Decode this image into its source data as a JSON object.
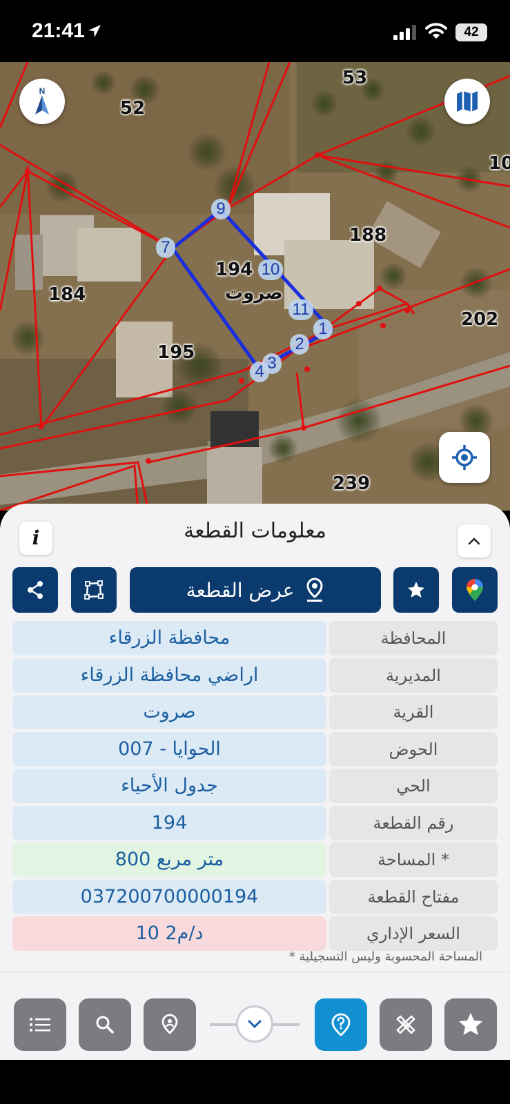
{
  "status_bar": {
    "time": "21:41",
    "battery": "42"
  },
  "map": {
    "parcels": [
      {
        "id": "p52",
        "label": "52"
      },
      {
        "id": "p53",
        "label": "53"
      },
      {
        "id": "p10x",
        "label": "10"
      },
      {
        "id": "p188",
        "label": "188"
      },
      {
        "id": "p184",
        "label": "184"
      },
      {
        "id": "p194",
        "label": "194"
      },
      {
        "id": "p195",
        "label": "195"
      },
      {
        "id": "p202",
        "label": "202"
      },
      {
        "id": "p239",
        "label": "239"
      }
    ],
    "village_label": "صروت",
    "vertices": [
      "9",
      "7",
      "10",
      "11",
      "1",
      "2",
      "3",
      "4"
    ],
    "north_label": "N"
  },
  "panel": {
    "title": "معلومات القطعة",
    "info_label": "i",
    "show_parcel_label": "عرض القطعة",
    "rows": [
      {
        "key": "المحافظة",
        "value": "محافظة الزرقاء"
      },
      {
        "key": "المديرية",
        "value": "اراضي محافظة الزرقاء"
      },
      {
        "key": "القرية",
        "value": "صروت"
      },
      {
        "key": "الحوض",
        "value": "الحوايا - 007"
      },
      {
        "key": "الحي",
        "value": "جدول الأحياء"
      },
      {
        "key": "رقم القطعة",
        "value": "194"
      },
      {
        "key": "المساحة *",
        "value": "800  متر مربع"
      },
      {
        "key": "مفتاح القطعة",
        "value": "037200700000194"
      },
      {
        "key": "السعر الإداري",
        "value": "10 د/م2"
      }
    ],
    "footnote": "* المساحة المحسوبة وليس التسجيلية"
  },
  "bottom_nav": {
    "items": [
      "list-icon",
      "search-icon",
      "location-pin-icon",
      "help-pin-icon",
      "ruler-tools-icon",
      "star-icon"
    ],
    "active": "help-pin-icon"
  },
  "colors": {
    "primary": "#0b3b6e",
    "accent": "#118fd0",
    "value_text": "#1b5fa0",
    "boundary_red": "#e01010",
    "parcel_blue": "#1a2ee0"
  }
}
